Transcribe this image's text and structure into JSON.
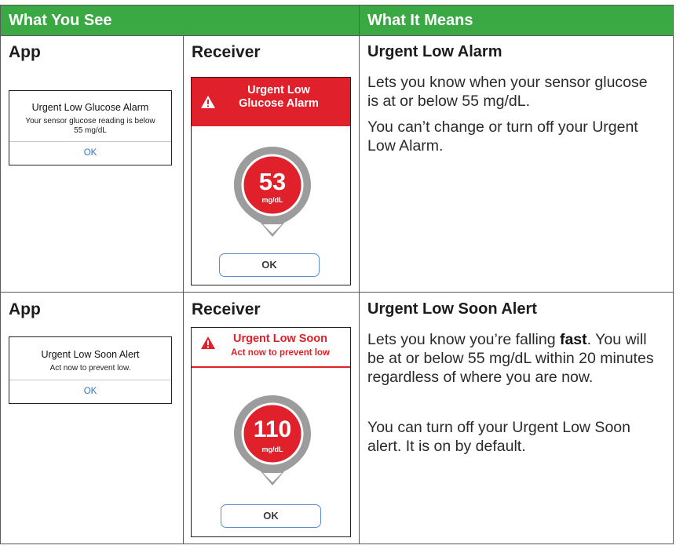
{
  "header": {
    "col1": "What You See",
    "col2": "What It Means"
  },
  "rows": [
    {
      "app_label": "App",
      "receiver_label": "Receiver",
      "app_dialog": {
        "title": "Urgent Low Glucose Alarm",
        "body_line1": "Your sensor glucose reading is below",
        "body_line2": "55 mg/dL",
        "ok": "OK"
      },
      "receiver_screen": {
        "title_line1": "Urgent Low",
        "title_line2": "Glucose Alarm",
        "value": "53",
        "unit": "mg/dL",
        "ok": "OK"
      },
      "title": "Urgent Low Alarm",
      "para1": "Lets you know when your sensor glucose is at or below 55 mg/dL.",
      "para2": "You can’t change or turn off your Urgent Low Alarm."
    },
    {
      "app_label": "App",
      "receiver_label": "Receiver",
      "app_dialog": {
        "title": "Urgent Low Soon Alert",
        "body_line1": "Act now to prevent low.",
        "ok": "OK"
      },
      "receiver_screen": {
        "title_line1": "Urgent Low Soon",
        "title_line2": "Act now to prevent low",
        "value": "110",
        "unit": "mg/dL",
        "ok": "OK"
      },
      "title": "Urgent Low Soon Alert",
      "para1_before": "Lets you know you’re falling ",
      "para1_bold": "fast",
      "para1_after": ". You will be at or below 55 mg/dL within 20 minutes regardless of where you are now.",
      "para2": "You can turn off your Urgent Low Soon alert. It is on by default."
    }
  ],
  "colors": {
    "header_green": "#3aa843",
    "alarm_red": "#e0202a",
    "ok_blue": "#3573c4"
  },
  "icons": [
    "warning-triangle-icon",
    "glucose-pin-icon",
    "down-arrow-icon"
  ]
}
